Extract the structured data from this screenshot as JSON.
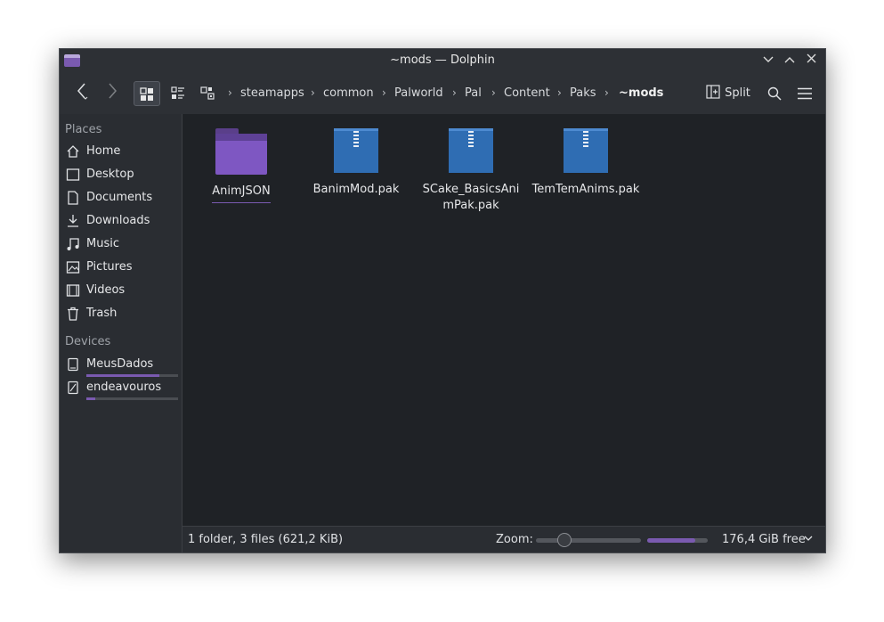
{
  "window": {
    "title": "~mods — Dolphin"
  },
  "toolbar": {
    "back_icon": "chevron-left-icon",
    "forward_icon": "chevron-right-icon",
    "split_label": "Split",
    "breadcrumbs": [
      "steamapps",
      "common",
      "Palworld",
      "Pal",
      "Content",
      "Paks",
      "~mods"
    ]
  },
  "sidebar": {
    "places_title": "Places",
    "places": [
      {
        "label": "Home",
        "icon": "home-icon"
      },
      {
        "label": "Desktop",
        "icon": "desktop-icon"
      },
      {
        "label": "Documents",
        "icon": "documents-icon"
      },
      {
        "label": "Downloads",
        "icon": "downloads-icon"
      },
      {
        "label": "Music",
        "icon": "music-icon"
      },
      {
        "label": "Pictures",
        "icon": "pictures-icon"
      },
      {
        "label": "Videos",
        "icon": "videos-icon"
      },
      {
        "label": "Trash",
        "icon": "trash-icon"
      }
    ],
    "devices_title": "Devices",
    "devices": [
      {
        "label": "MeusDados",
        "icon": "drive-icon",
        "usage_fraction": 0.8
      },
      {
        "label": "endeavouros",
        "icon": "drive-root-icon",
        "usage_fraction": 0.1
      }
    ]
  },
  "files": [
    {
      "name": "AnimJSON",
      "type": "folder"
    },
    {
      "name": "BanimMod.pak",
      "type": "archive"
    },
    {
      "name": "SCake_BasicsAnimPak.pak",
      "type": "archive"
    },
    {
      "name": "TemTemAnims.pak",
      "type": "archive"
    }
  ],
  "status": {
    "summary": "1 folder, 3 files (621,2 KiB)",
    "zoom_label": "Zoom:",
    "zoom_fraction": 0.25,
    "free_space": "176,4 GiB free",
    "disk_used_fraction": 0.8
  },
  "colors": {
    "accent": "#7e57c2",
    "archive": "#2f6db3",
    "background": "#1f2226"
  }
}
